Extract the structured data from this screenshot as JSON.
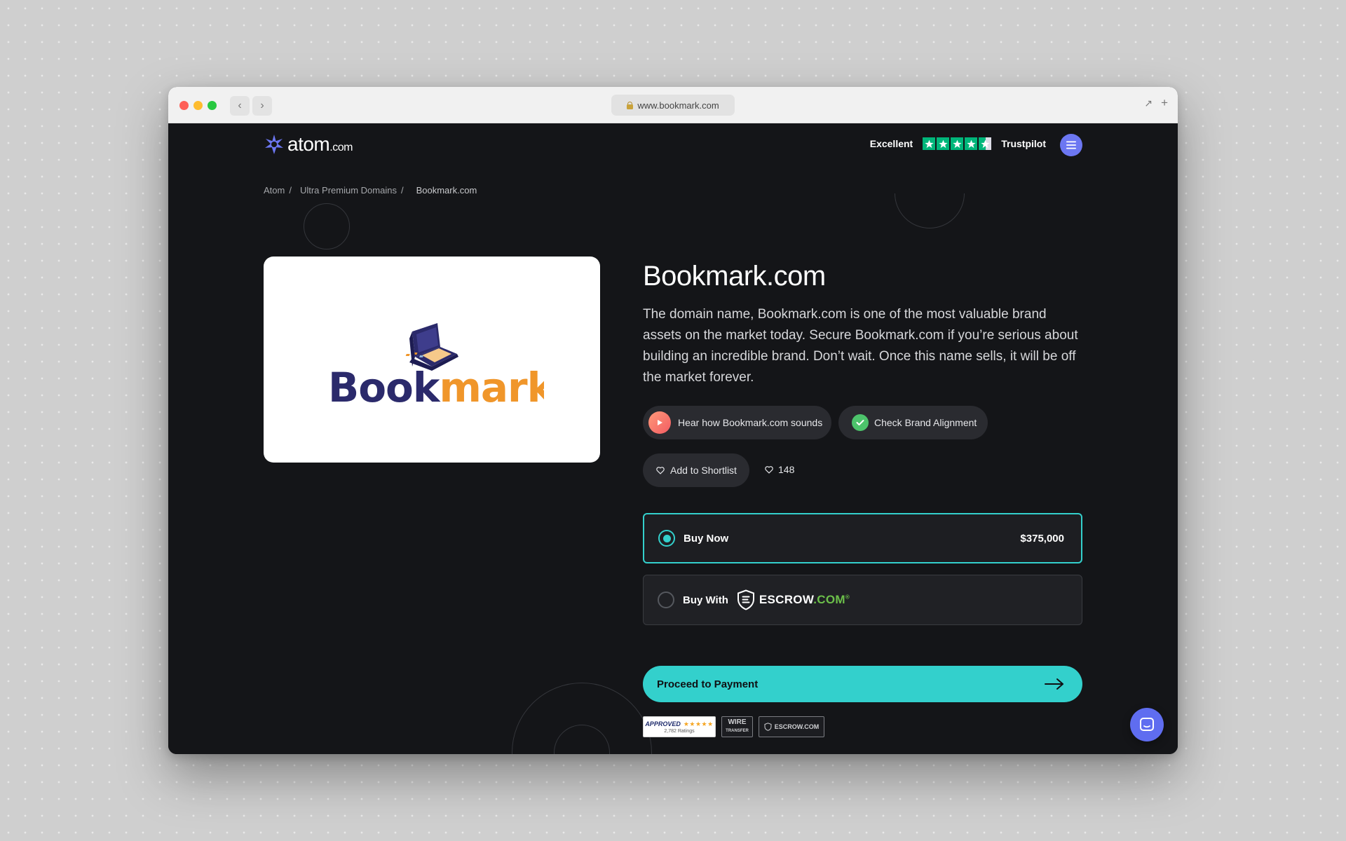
{
  "browser": {
    "url": "www.bookmark.com",
    "back_label": "‹",
    "forward_label": "›"
  },
  "header": {
    "logo_text": "atom",
    "logo_suffix": ".com",
    "trustpilot_rating_label": "Excellent",
    "trustpilot_stars": 4.5,
    "trustpilot_brand": "Trustpilot"
  },
  "breadcrumb": {
    "items": [
      "Atom",
      "Ultra Premium Domains",
      "Bookmark.com"
    ],
    "separator": "/"
  },
  "domain_logo": {
    "book_text": "Book",
    "mark_text": "mark",
    "book_color": "#2b2a6b",
    "mark_color": "#f0962a"
  },
  "main": {
    "title": "Bookmark.com",
    "description": "The domain name, Bookmark.com is one of the most valuable brand assets on the market today. Secure Bookmark.com if you’re serious about building an incredible brand. Don’t wait. Once this name sells, it will be off the market forever.",
    "hear_label": "Hear how Bookmark.com sounds",
    "brand_label": "Check Brand Alignment",
    "shortlist_label": "Add to Shortlist",
    "likes_count": "148"
  },
  "purchase": {
    "buy_now_label": "Buy Now",
    "buy_now_price": "$375,000",
    "buy_now_selected": true,
    "escrow_label": "Buy With",
    "escrow_brand": "ESCROW",
    "escrow_brand_suffix": ".COM",
    "escrow_registered": "®",
    "proceed_label": "Proceed to Payment"
  },
  "badges": {
    "approved_label": "APPROVED",
    "approved_stars": "★★★★★",
    "approved_ratings": "2,782 Ratings",
    "wire_label_1": "WIRE",
    "wire_label_2": "TRANSFER",
    "escrow_label": "ESCROW.COM"
  },
  "colors": {
    "accent": "#33d0cc",
    "background": "#141518",
    "trustpilot_green": "#00b67a",
    "menu_button": "#6c77f2",
    "chat_button": "#5f6df0",
    "escrow_green": "#6cc04a"
  },
  "icons": {
    "logo": "atom-star-icon",
    "menu": "hamburger-menu-icon",
    "play": "play-icon",
    "check": "check-circle-icon",
    "heart": "heart-icon",
    "arrow": "arrow-right-icon",
    "chat": "chat-bubble-icon",
    "shield": "escrow-shield-icon",
    "lock": "lock-icon"
  }
}
